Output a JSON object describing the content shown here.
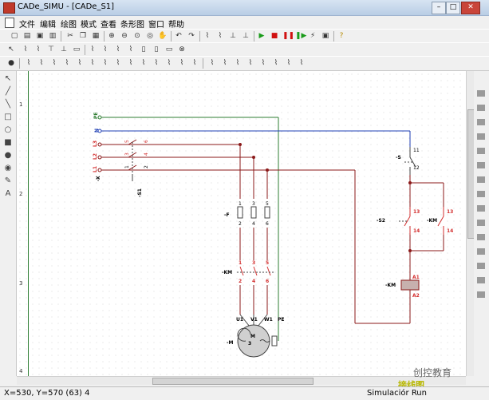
{
  "window": {
    "title": "CADe_SIMU - [CADe_S1]"
  },
  "menu": [
    "文件",
    "编辑",
    "绘图",
    "模式",
    "查看",
    "条形图",
    "窗口",
    "帮助"
  ],
  "schematic": {
    "row_numbers": [
      "1",
      "2",
      "3",
      "4"
    ],
    "terminals": {
      "pe": "PE",
      "n": "N",
      "l3": "L3",
      "l2": "L2",
      "l1": "L1",
      "x": "-X"
    },
    "switch_s1": {
      "label": "-S1",
      "t1": "1",
      "t2": "2",
      "t3": "3",
      "t4": "4",
      "t5": "5",
      "t6": "6"
    },
    "fuse": {
      "label": "-F",
      "pins": [
        "1",
        "3",
        "5",
        "2",
        "4",
        "6"
      ]
    },
    "contactor_main": {
      "label": "-KM",
      "pins": [
        "1",
        "3",
        "5",
        "2",
        "4",
        "6"
      ]
    },
    "motor": {
      "label": "-M",
      "terminals": [
        "U1",
        "V1",
        "W1",
        "PE"
      ],
      "text": "M",
      "phase": "3"
    },
    "stop_button": {
      "label": "-S",
      "top": "11",
      "bottom": "12"
    },
    "start_button": {
      "label": "-S2",
      "top": "13",
      "bottom": "14"
    },
    "aux_contact": {
      "label": "-KM",
      "top": "13",
      "bottom": "14"
    },
    "coil": {
      "label": "-KM",
      "a1": "A1",
      "a2": "A2"
    }
  },
  "status": {
    "coords": "X=530, Y=570 (63) 4",
    "mode": "Simulaciór",
    "run": "Run"
  },
  "watermark": {
    "line1": "创控教育",
    "line2": "接线图"
  },
  "colors": {
    "pe_wire": "#2e7d32",
    "n_wire": "#1f3fb5",
    "phase_wire": "#8b1a1a",
    "component_red": "#d32f2f"
  }
}
